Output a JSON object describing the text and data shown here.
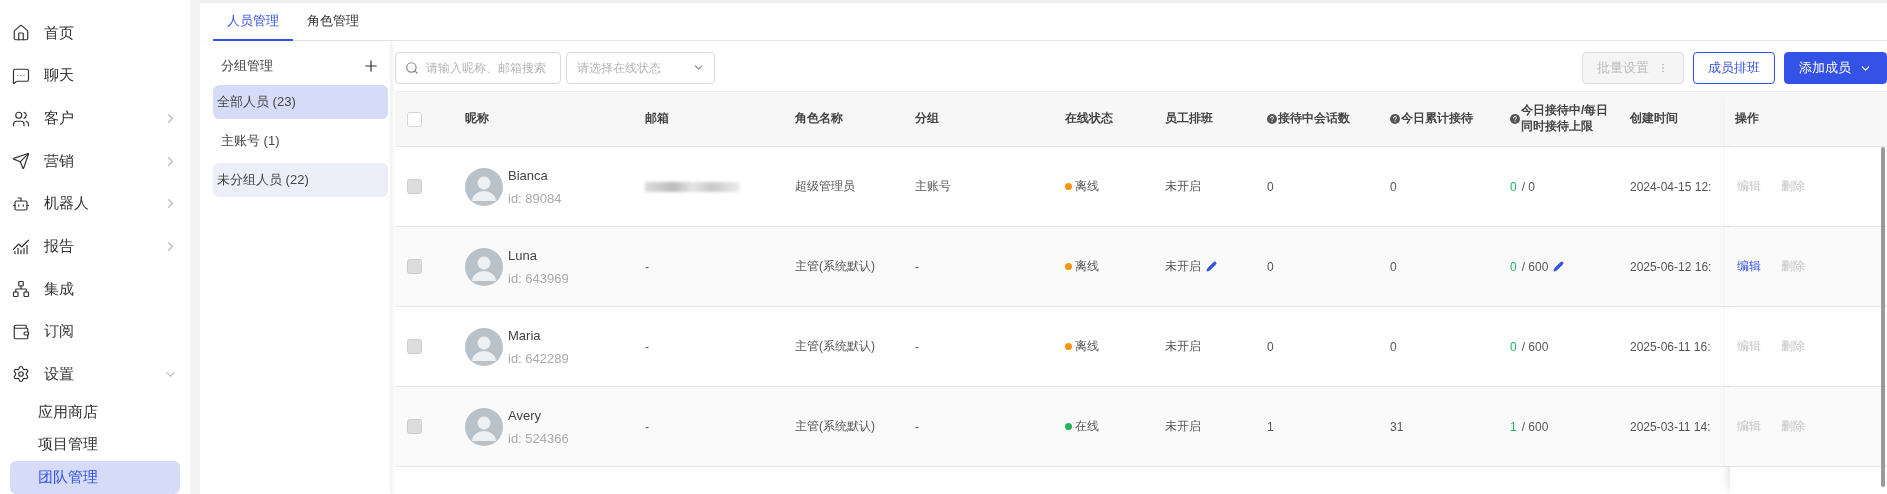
{
  "sidebar": {
    "items": [
      {
        "label": "首页",
        "has_submenu": false
      },
      {
        "label": "聊天",
        "has_submenu": false
      },
      {
        "label": "客户",
        "has_submenu": true,
        "expanded": false
      },
      {
        "label": "营销",
        "has_submenu": true,
        "expanded": false
      },
      {
        "label": "机器人",
        "has_submenu": true,
        "expanded": false
      },
      {
        "label": "报告",
        "has_submenu": true,
        "expanded": false
      },
      {
        "label": "集成",
        "has_submenu": false
      },
      {
        "label": "订阅",
        "has_submenu": false
      },
      {
        "label": "设置",
        "has_submenu": true,
        "expanded": true,
        "children": [
          {
            "label": "应用商店",
            "selected": false
          },
          {
            "label": "项目管理",
            "selected": false
          },
          {
            "label": "团队管理",
            "selected": true
          }
        ]
      }
    ]
  },
  "tabs": [
    {
      "label": "人员管理",
      "selected": true
    },
    {
      "label": "角色管理",
      "selected": false
    }
  ],
  "groups": {
    "title": "分组管理",
    "items": [
      {
        "label": "全部人员 (23)",
        "selected": true,
        "highlighted": false
      },
      {
        "label": "主账号 (1)",
        "selected": false,
        "highlighted": false
      },
      {
        "label": "未分组人员 (22)",
        "selected": false,
        "highlighted": true
      }
    ]
  },
  "filters": {
    "search": {
      "placeholder": "请输入昵称、邮箱搜索"
    },
    "status_select": {
      "placeholder": "请选择在线状态"
    }
  },
  "buttons": [
    {
      "label": "批量设置",
      "kind": "menu",
      "disabled": true
    },
    {
      "label": "成员排班",
      "kind": "outline",
      "disabled": false
    },
    {
      "label": "添加成员",
      "kind": "dropdown",
      "disabled": false
    }
  ],
  "table": {
    "select_all": {
      "checked": false
    },
    "columns": [
      {
        "label": "昵称",
        "help": false
      },
      {
        "label": "邮箱",
        "help": false
      },
      {
        "label": "角色名称",
        "help": false
      },
      {
        "label": "分组",
        "help": false
      },
      {
        "label": "在线状态",
        "help": false
      },
      {
        "label": "员工排班",
        "help": false
      },
      {
        "label": "接待中会话数",
        "help": true
      },
      {
        "label": "今日累计接待",
        "help": true
      },
      {
        "label": "今日接待中/每日同时接待上限",
        "help": true
      },
      {
        "label": "创建时间",
        "help": false
      },
      {
        "label": "操作",
        "help": false
      }
    ],
    "rows": [
      {
        "checked": false,
        "disabled": true,
        "name": "Bianca",
        "id": "id: 89084",
        "email": null,
        "email_redacted": true,
        "role": "超级管理员",
        "group": "主账号",
        "status": "离线",
        "color": "#f5960a",
        "schedule": "未开启",
        "schedule_editable": false,
        "sessions": "0",
        "today": "0",
        "current": "0",
        "limit": "/ 0",
        "limit_editable": false,
        "created": "2024-04-15 12:",
        "edit": {
          "label": "编辑",
          "disabled": true
        },
        "delete": {
          "label": "删除",
          "disabled": true
        }
      },
      {
        "checked": false,
        "disabled": true,
        "name": "Luna",
        "id": "id: 643969",
        "email": "-",
        "email_redacted": false,
        "role": "主管(系统默认)",
        "group": "-",
        "status": "离线",
        "color": "#f5960a",
        "schedule": "未开启",
        "schedule_editable": true,
        "sessions": "0",
        "today": "0",
        "current": "0",
        "limit": "/ 600",
        "limit_editable": true,
        "created": "2025-06-12 16:",
        "edit": {
          "label": "编辑",
          "disabled": false
        },
        "delete": {
          "label": "删除",
          "disabled": true
        }
      },
      {
        "checked": false,
        "disabled": true,
        "name": "Maria",
        "id": "id: 642289",
        "email": "-",
        "email_redacted": false,
        "role": "主管(系统默认)",
        "group": "-",
        "status": "离线",
        "color": "#f5960a",
        "schedule": "未开启",
        "schedule_editable": false,
        "sessions": "0",
        "today": "0",
        "current": "0",
        "limit": "/ 600",
        "limit_editable": false,
        "created": "2025-06-11 16:",
        "edit": {
          "label": "编辑",
          "disabled": true
        },
        "delete": {
          "label": "删除",
          "disabled": true
        }
      },
      {
        "checked": false,
        "disabled": true,
        "name": "Avery",
        "id": "id: 524366",
        "email": "-",
        "email_redacted": false,
        "role": "主管(系统默认)",
        "group": "-",
        "status": "在线",
        "color": "#22b35e",
        "schedule": "未开启",
        "schedule_editable": false,
        "sessions": "1",
        "today": "31",
        "current": "1",
        "limit": "/ 600",
        "limit_editable": false,
        "created": "2025-03-11 14:",
        "edit": {
          "label": "编辑",
          "disabled": true
        },
        "delete": {
          "label": "删除",
          "disabled": true
        }
      }
    ]
  }
}
